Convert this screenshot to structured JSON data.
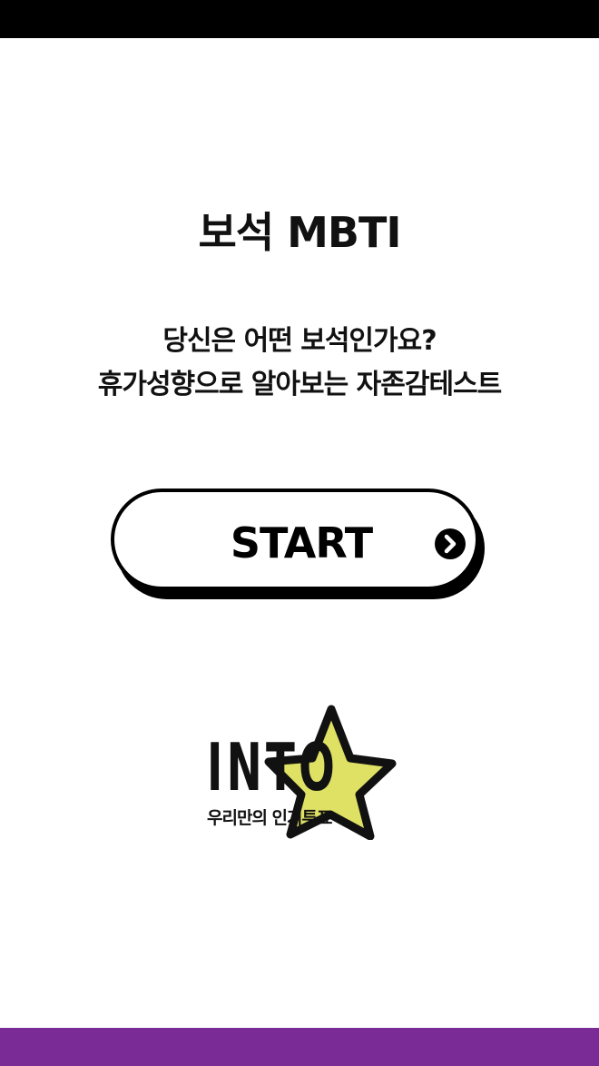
{
  "title": "보석 MBTI",
  "subtitle": {
    "line1": "당신은 어떤 보석인가요?",
    "line2": "휴가성향으로 알아보는 자존감테스트"
  },
  "start_button": {
    "label": "START",
    "icon": "chevron-right-circle-icon"
  },
  "logo": {
    "text": "INTO",
    "tagline": "우리만의 인기투표",
    "star_color": "#dfe164",
    "icon": "star-icon"
  },
  "colors": {
    "top_bar": "#000000",
    "bottom_bar": "#7a2b96",
    "text": "#111111"
  }
}
